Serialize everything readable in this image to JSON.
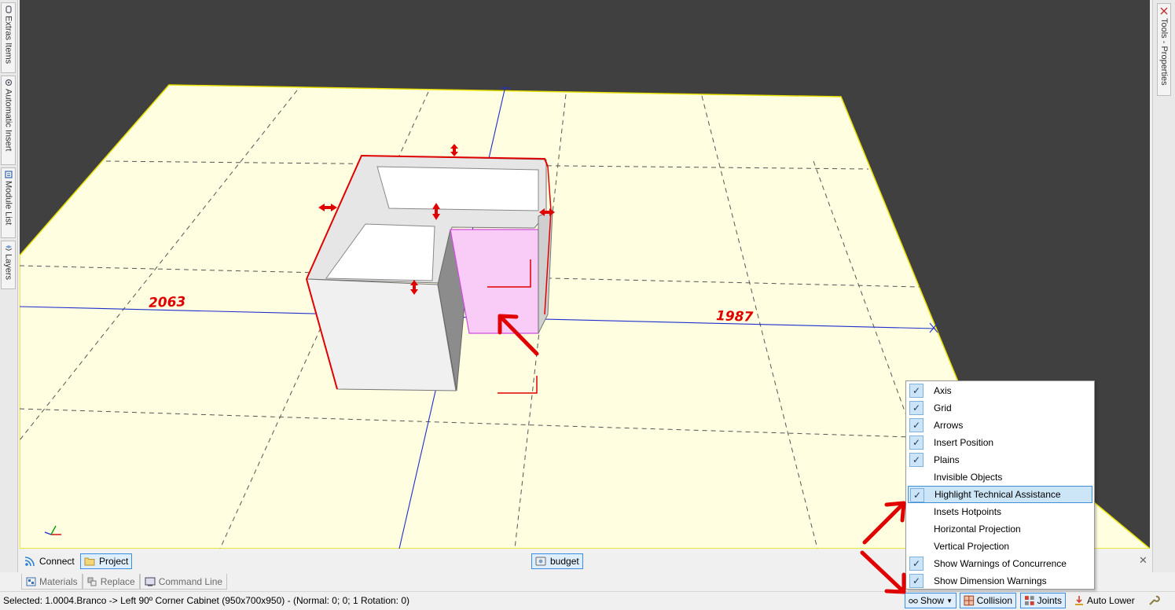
{
  "left_rail": {
    "tabs": [
      {
        "label": "Extras Items",
        "icon": "extras-icon"
      },
      {
        "label": "Automatic Insert",
        "icon": "automatic-insert-icon"
      },
      {
        "label": "Module List",
        "icon": "module-list-icon"
      },
      {
        "label": "Layers",
        "icon": "layers-icon"
      }
    ]
  },
  "right_rail": {
    "tabs": [
      {
        "label": "Tools - Properties",
        "icon": "tools-icon"
      }
    ]
  },
  "viewport": {
    "dimension_left": "2063",
    "dimension_right": "1987",
    "floor_color": "#fffee0",
    "background_color": "#404040",
    "highlight_color": "#f8ccf6",
    "dimension_color": "#e00000"
  },
  "dock": {
    "connect_label": "Connect",
    "project_label": "Project",
    "budget_label": "budget",
    "close_glyph": "✕"
  },
  "bottom_tabs": {
    "materials": "Materials",
    "replace": "Replace",
    "command_line": "Command Line"
  },
  "status": {
    "text": "Selected: 1.0004.Branco -> Left 90º Corner Cabinet (950x700x950) - (Normal: 0; 0; 1 Rotation: 0)",
    "show_label": "Show",
    "collision_label": "Collision",
    "joints_label": "Joints",
    "auto_lower_label": "Auto Lower"
  },
  "show_menu": {
    "items": [
      {
        "label": "Axis",
        "checked": true
      },
      {
        "label": "Grid",
        "checked": true
      },
      {
        "label": "Arrows",
        "checked": true
      },
      {
        "label": "Insert Position",
        "checked": true
      },
      {
        "label": "Plains",
        "checked": true
      },
      {
        "label": "Invisible Objects",
        "checked": false
      },
      {
        "label": "Highlight Technical Assistance",
        "checked": true,
        "highlighted": true
      },
      {
        "label": "Insets Hotpoints",
        "checked": false
      },
      {
        "label": "Horizontal Projection",
        "checked": false
      },
      {
        "label": "Vertical Projection",
        "checked": false
      },
      {
        "label": "Show Warnings of Concurrence",
        "checked": true
      },
      {
        "label": "Show Dimension Warnings",
        "checked": true
      }
    ],
    "check_glyph": "✓"
  }
}
